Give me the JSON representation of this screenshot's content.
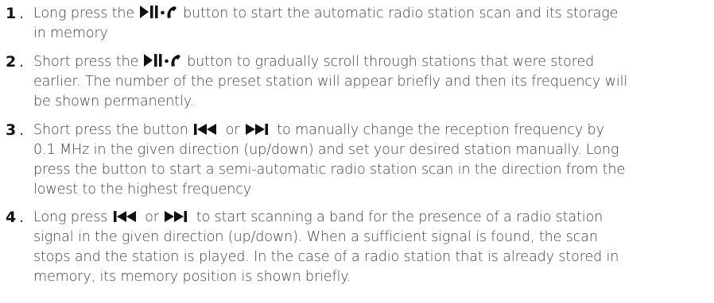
{
  "items": [
    {
      "number": "1",
      "sep": ".",
      "l1_pre": "Long press the",
      "l1_post": "button to start the automatic radio station scan and its storage",
      "l2": "in memory"
    },
    {
      "number": "2",
      "sep": ".",
      "l1_pre": "Short press the",
      "l1_post": "button to gradually scroll through stations that were stored",
      "l2": "earlier. The number of the preset station will appear briefly and then its frequency will",
      "l3": "be shown permanently."
    },
    {
      "number": "3",
      "sep": ".",
      "l1_pre": "Short press the button",
      "l1_mid": "or",
      "l1_post": "to manually change the reception frequency by",
      "l2": "0.1 MHz in the given direction (up/down) and set your desired station manually. Long",
      "l3": "press the button to start a semi-automatic radio station scan in the direction from the",
      "l4": "lowest to the highest frequency"
    },
    {
      "number": "4",
      "sep": ".",
      "l1_pre": "Long press",
      "l1_mid": "or",
      "l1_post": "to start scanning a band for the presence of a radio station",
      "l2": "signal in the given direction (up/down). When a sufficient signal is found, the scan",
      "l3": "stops and the station is played. In the case of a radio station that is already stored in",
      "l4": "memory, its memory position is shown briefly."
    }
  ],
  "icons": {
    "play_pause_call": "play-pause-call-icon",
    "previous": "previous-track-icon",
    "next": "next-track-icon"
  }
}
